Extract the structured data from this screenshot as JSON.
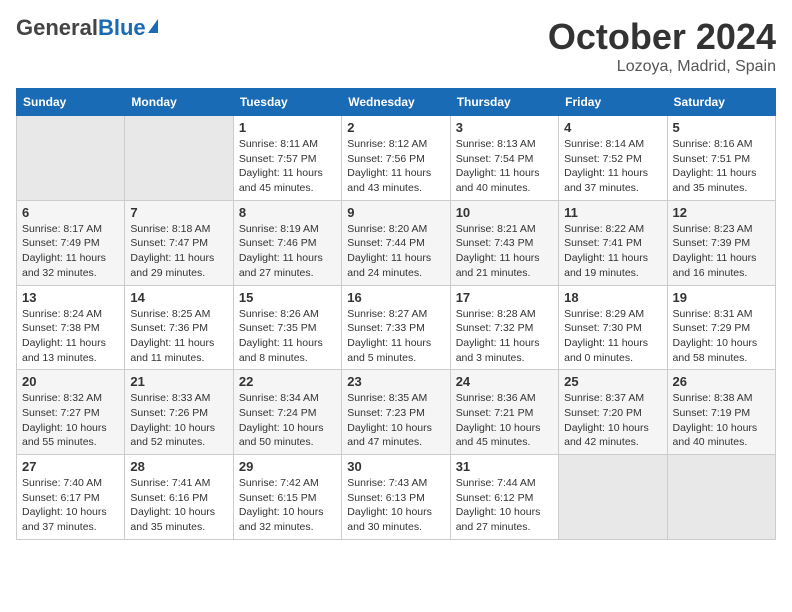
{
  "header": {
    "logo_general": "General",
    "logo_blue": "Blue",
    "title": "October 2024",
    "subtitle": "Lozoya, Madrid, Spain"
  },
  "days_of_week": [
    "Sunday",
    "Monday",
    "Tuesday",
    "Wednesday",
    "Thursday",
    "Friday",
    "Saturday"
  ],
  "weeks": [
    [
      {
        "day": "",
        "sunrise": "",
        "sunset": "",
        "daylight": ""
      },
      {
        "day": "",
        "sunrise": "",
        "sunset": "",
        "daylight": ""
      },
      {
        "day": "1",
        "sunrise": "Sunrise: 8:11 AM",
        "sunset": "Sunset: 7:57 PM",
        "daylight": "Daylight: 11 hours and 45 minutes."
      },
      {
        "day": "2",
        "sunrise": "Sunrise: 8:12 AM",
        "sunset": "Sunset: 7:56 PM",
        "daylight": "Daylight: 11 hours and 43 minutes."
      },
      {
        "day": "3",
        "sunrise": "Sunrise: 8:13 AM",
        "sunset": "Sunset: 7:54 PM",
        "daylight": "Daylight: 11 hours and 40 minutes."
      },
      {
        "day": "4",
        "sunrise": "Sunrise: 8:14 AM",
        "sunset": "Sunset: 7:52 PM",
        "daylight": "Daylight: 11 hours and 37 minutes."
      },
      {
        "day": "5",
        "sunrise": "Sunrise: 8:16 AM",
        "sunset": "Sunset: 7:51 PM",
        "daylight": "Daylight: 11 hours and 35 minutes."
      }
    ],
    [
      {
        "day": "6",
        "sunrise": "Sunrise: 8:17 AM",
        "sunset": "Sunset: 7:49 PM",
        "daylight": "Daylight: 11 hours and 32 minutes."
      },
      {
        "day": "7",
        "sunrise": "Sunrise: 8:18 AM",
        "sunset": "Sunset: 7:47 PM",
        "daylight": "Daylight: 11 hours and 29 minutes."
      },
      {
        "day": "8",
        "sunrise": "Sunrise: 8:19 AM",
        "sunset": "Sunset: 7:46 PM",
        "daylight": "Daylight: 11 hours and 27 minutes."
      },
      {
        "day": "9",
        "sunrise": "Sunrise: 8:20 AM",
        "sunset": "Sunset: 7:44 PM",
        "daylight": "Daylight: 11 hours and 24 minutes."
      },
      {
        "day": "10",
        "sunrise": "Sunrise: 8:21 AM",
        "sunset": "Sunset: 7:43 PM",
        "daylight": "Daylight: 11 hours and 21 minutes."
      },
      {
        "day": "11",
        "sunrise": "Sunrise: 8:22 AM",
        "sunset": "Sunset: 7:41 PM",
        "daylight": "Daylight: 11 hours and 19 minutes."
      },
      {
        "day": "12",
        "sunrise": "Sunrise: 8:23 AM",
        "sunset": "Sunset: 7:39 PM",
        "daylight": "Daylight: 11 hours and 16 minutes."
      }
    ],
    [
      {
        "day": "13",
        "sunrise": "Sunrise: 8:24 AM",
        "sunset": "Sunset: 7:38 PM",
        "daylight": "Daylight: 11 hours and 13 minutes."
      },
      {
        "day": "14",
        "sunrise": "Sunrise: 8:25 AM",
        "sunset": "Sunset: 7:36 PM",
        "daylight": "Daylight: 11 hours and 11 minutes."
      },
      {
        "day": "15",
        "sunrise": "Sunrise: 8:26 AM",
        "sunset": "Sunset: 7:35 PM",
        "daylight": "Daylight: 11 hours and 8 minutes."
      },
      {
        "day": "16",
        "sunrise": "Sunrise: 8:27 AM",
        "sunset": "Sunset: 7:33 PM",
        "daylight": "Daylight: 11 hours and 5 minutes."
      },
      {
        "day": "17",
        "sunrise": "Sunrise: 8:28 AM",
        "sunset": "Sunset: 7:32 PM",
        "daylight": "Daylight: 11 hours and 3 minutes."
      },
      {
        "day": "18",
        "sunrise": "Sunrise: 8:29 AM",
        "sunset": "Sunset: 7:30 PM",
        "daylight": "Daylight: 11 hours and 0 minutes."
      },
      {
        "day": "19",
        "sunrise": "Sunrise: 8:31 AM",
        "sunset": "Sunset: 7:29 PM",
        "daylight": "Daylight: 10 hours and 58 minutes."
      }
    ],
    [
      {
        "day": "20",
        "sunrise": "Sunrise: 8:32 AM",
        "sunset": "Sunset: 7:27 PM",
        "daylight": "Daylight: 10 hours and 55 minutes."
      },
      {
        "day": "21",
        "sunrise": "Sunrise: 8:33 AM",
        "sunset": "Sunset: 7:26 PM",
        "daylight": "Daylight: 10 hours and 52 minutes."
      },
      {
        "day": "22",
        "sunrise": "Sunrise: 8:34 AM",
        "sunset": "Sunset: 7:24 PM",
        "daylight": "Daylight: 10 hours and 50 minutes."
      },
      {
        "day": "23",
        "sunrise": "Sunrise: 8:35 AM",
        "sunset": "Sunset: 7:23 PM",
        "daylight": "Daylight: 10 hours and 47 minutes."
      },
      {
        "day": "24",
        "sunrise": "Sunrise: 8:36 AM",
        "sunset": "Sunset: 7:21 PM",
        "daylight": "Daylight: 10 hours and 45 minutes."
      },
      {
        "day": "25",
        "sunrise": "Sunrise: 8:37 AM",
        "sunset": "Sunset: 7:20 PM",
        "daylight": "Daylight: 10 hours and 42 minutes."
      },
      {
        "day": "26",
        "sunrise": "Sunrise: 8:38 AM",
        "sunset": "Sunset: 7:19 PM",
        "daylight": "Daylight: 10 hours and 40 minutes."
      }
    ],
    [
      {
        "day": "27",
        "sunrise": "Sunrise: 7:40 AM",
        "sunset": "Sunset: 6:17 PM",
        "daylight": "Daylight: 10 hours and 37 minutes."
      },
      {
        "day": "28",
        "sunrise": "Sunrise: 7:41 AM",
        "sunset": "Sunset: 6:16 PM",
        "daylight": "Daylight: 10 hours and 35 minutes."
      },
      {
        "day": "29",
        "sunrise": "Sunrise: 7:42 AM",
        "sunset": "Sunset: 6:15 PM",
        "daylight": "Daylight: 10 hours and 32 minutes."
      },
      {
        "day": "30",
        "sunrise": "Sunrise: 7:43 AM",
        "sunset": "Sunset: 6:13 PM",
        "daylight": "Daylight: 10 hours and 30 minutes."
      },
      {
        "day": "31",
        "sunrise": "Sunrise: 7:44 AM",
        "sunset": "Sunset: 6:12 PM",
        "daylight": "Daylight: 10 hours and 27 minutes."
      },
      {
        "day": "",
        "sunrise": "",
        "sunset": "",
        "daylight": ""
      },
      {
        "day": "",
        "sunrise": "",
        "sunset": "",
        "daylight": ""
      }
    ]
  ]
}
